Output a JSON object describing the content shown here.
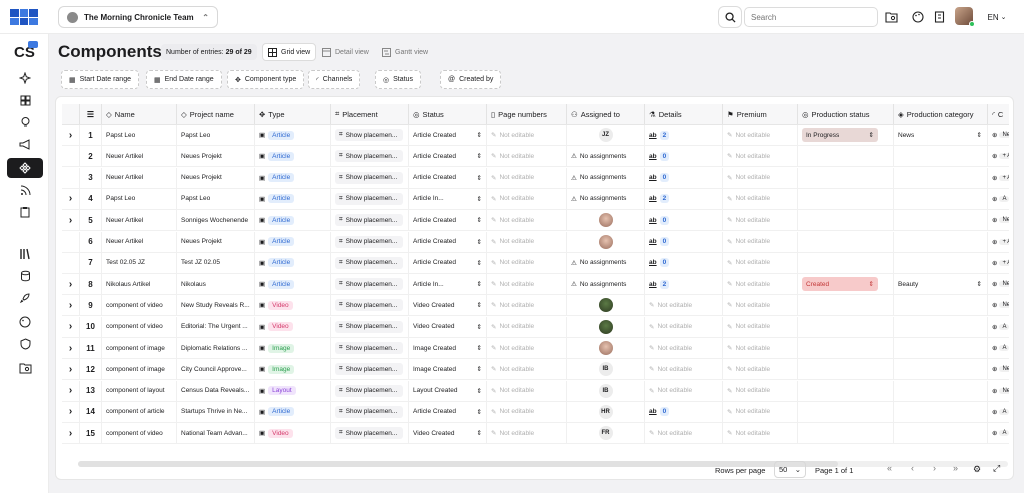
{
  "app": {
    "team_name": "The Morning Chronicle Team",
    "search_placeholder": "Search",
    "language": "EN",
    "logo_text": "CS"
  },
  "page": {
    "title": "Components",
    "entries_label": "Number of entries:",
    "entries_value": "29 of 29",
    "views": [
      {
        "label": "Grid view",
        "active": true
      },
      {
        "label": "Detail view",
        "active": false
      },
      {
        "label": "Gantt view",
        "active": false
      }
    ],
    "filters": [
      "Start Date range",
      "End Date range",
      "Component type",
      "Channels",
      "Status",
      "Created by"
    ]
  },
  "columns": [
    "Name",
    "Project name",
    "Type",
    "Placement",
    "Status",
    "Page numbers",
    "Assigned to",
    "Details",
    "Premium",
    "Production status",
    "Production category",
    "C"
  ],
  "rows": [
    {
      "num": "1",
      "expand": true,
      "name": "Papst Leo",
      "project": "Papst Leo",
      "type": "Article",
      "placement": "Show placemen...",
      "status": "Article Created",
      "page": "Not editable",
      "assigned": "JZ",
      "assigned_kind": "initials",
      "details": "2",
      "premium": "Not editable",
      "prod_status": "In Progress",
      "prod_kind": "progress",
      "prod_cat": "News",
      "last": "Ne"
    },
    {
      "num": "2",
      "expand": false,
      "name": "Neuer Artikel",
      "project": "Neues Projekt",
      "type": "Article",
      "placement": "Show placemen...",
      "status": "Article Created",
      "page": "Not editable",
      "assigned": "No assignments",
      "assigned_kind": "none",
      "details": "0",
      "premium": "Not editable",
      "prod_status": "",
      "prod_kind": "",
      "prod_cat": "",
      "last": "+ A"
    },
    {
      "num": "3",
      "expand": false,
      "name": "Neuer Artikel",
      "project": "Neues Projekt",
      "type": "Article",
      "placement": "Show placemen...",
      "status": "Article Created",
      "page": "Not editable",
      "assigned": "No assignments",
      "assigned_kind": "none",
      "details": "0",
      "premium": "Not editable",
      "prod_status": "",
      "prod_kind": "",
      "prod_cat": "",
      "last": "+ A"
    },
    {
      "num": "4",
      "expand": true,
      "name": "Papst Leo",
      "project": "Papst Leo",
      "type": "Article",
      "placement": "Show placemen...",
      "status": "Article In...",
      "page": "Not editable",
      "assigned": "No assignments",
      "assigned_kind": "none",
      "details": "2",
      "premium": "Not editable",
      "prod_status": "",
      "prod_kind": "",
      "prod_cat": "",
      "last": "A"
    },
    {
      "num": "5",
      "expand": true,
      "name": "Neuer Artikel",
      "project": "Sonniges Wochenende",
      "type": "Article",
      "placement": "Show placemen...",
      "status": "Article Created",
      "page": "Not editable",
      "assigned": "",
      "assigned_kind": "photo",
      "details": "0",
      "premium": "Not editable",
      "prod_status": "",
      "prod_kind": "",
      "prod_cat": "",
      "last": "Ne"
    },
    {
      "num": "6",
      "expand": false,
      "name": "Neuer Artikel",
      "project": "Neues Projekt",
      "type": "Article",
      "placement": "Show placemen...",
      "status": "Article Created",
      "page": "Not editable",
      "assigned": "",
      "assigned_kind": "photo",
      "details": "0",
      "premium": "Not editable",
      "prod_status": "",
      "prod_kind": "",
      "prod_cat": "",
      "last": "+ A"
    },
    {
      "num": "7",
      "expand": false,
      "name": "Test 02.05 JZ",
      "project": "Test JZ 02.05",
      "type": "Article",
      "placement": "Show placemen...",
      "status": "Article Created",
      "page": "Not editable",
      "assigned": "No assignments",
      "assigned_kind": "none",
      "details": "0",
      "premium": "Not editable",
      "prod_status": "",
      "prod_kind": "",
      "prod_cat": "",
      "last": "+ A"
    },
    {
      "num": "8",
      "expand": true,
      "name": "Nikolaus Artikel",
      "project": "Nikolaus",
      "type": "Article",
      "placement": "Show placemen...",
      "status": "Article In...",
      "page": "Not editable",
      "assigned": "No assignments",
      "assigned_kind": "none",
      "details": "2",
      "premium": "Not editable",
      "prod_status": "Created",
      "prod_kind": "created",
      "prod_cat": "Beauty",
      "last": "Ne"
    },
    {
      "num": "9",
      "expand": true,
      "name": "component of video",
      "project": "New Study Reveals R...",
      "type": "Video",
      "placement": "Show placemen...",
      "status": "Video Created",
      "page": "Not editable",
      "assigned": "",
      "assigned_kind": "photo-dark",
      "details": "Not editable",
      "premium": "Not editable",
      "prod_status": "",
      "prod_kind": "",
      "prod_cat": "",
      "last": "Ne"
    },
    {
      "num": "10",
      "expand": true,
      "name": "component of video",
      "project": "Editorial: The Urgent ...",
      "type": "Video",
      "placement": "Show placemen...",
      "status": "Video Created",
      "page": "Not editable",
      "assigned": "",
      "assigned_kind": "photo-dark",
      "details": "Not editable",
      "premium": "Not editable",
      "prod_status": "",
      "prod_kind": "",
      "prod_cat": "",
      "last": "A"
    },
    {
      "num": "11",
      "expand": true,
      "name": "component of image",
      "project": "Diplomatic Relations ...",
      "type": "Image",
      "placement": "Show placemen...",
      "status": "Image Created",
      "page": "Not editable",
      "assigned": "",
      "assigned_kind": "photo",
      "details": "Not editable",
      "premium": "Not editable",
      "prod_status": "",
      "prod_kind": "",
      "prod_cat": "",
      "last": "A"
    },
    {
      "num": "12",
      "expand": true,
      "name": "component of image",
      "project": "City Council Approve...",
      "type": "Image",
      "placement": "Show placemen...",
      "status": "Image Created",
      "page": "Not editable",
      "assigned": "IB",
      "assigned_kind": "initials",
      "details": "Not editable",
      "premium": "Not editable",
      "prod_status": "",
      "prod_kind": "",
      "prod_cat": "",
      "last": "Ne"
    },
    {
      "num": "13",
      "expand": true,
      "name": "component of layout",
      "project": "Census Data Reveals...",
      "type": "Layout",
      "placement": "Show placemen...",
      "status": "Layout Created",
      "page": "Not editable",
      "assigned": "IB",
      "assigned_kind": "initials",
      "details": "Not editable",
      "premium": "Not editable",
      "prod_status": "",
      "prod_kind": "",
      "prod_cat": "",
      "last": "Ne"
    },
    {
      "num": "14",
      "expand": true,
      "name": "component of article",
      "project": "Startups Thrive in Ne...",
      "type": "Article",
      "placement": "Show placemen...",
      "status": "Article Created",
      "page": "Not editable",
      "assigned": "HR",
      "assigned_kind": "initials",
      "details": "0",
      "premium": "Not editable",
      "prod_status": "",
      "prod_kind": "",
      "prod_cat": "",
      "last": "A"
    },
    {
      "num": "15",
      "expand": true,
      "name": "component of video",
      "project": "National Team Advan...",
      "type": "Video",
      "placement": "Show placemen...",
      "status": "Video Created",
      "page": "Not editable",
      "assigned": "FR",
      "assigned_kind": "initials",
      "details": "Not editable",
      "premium": "Not editable",
      "prod_status": "",
      "prod_kind": "",
      "prod_cat": "",
      "last": "A"
    }
  ],
  "footer": {
    "rows_per_page_label": "Rows per page",
    "rows_per_page": "50",
    "page_label": "Page 1 of 1"
  }
}
